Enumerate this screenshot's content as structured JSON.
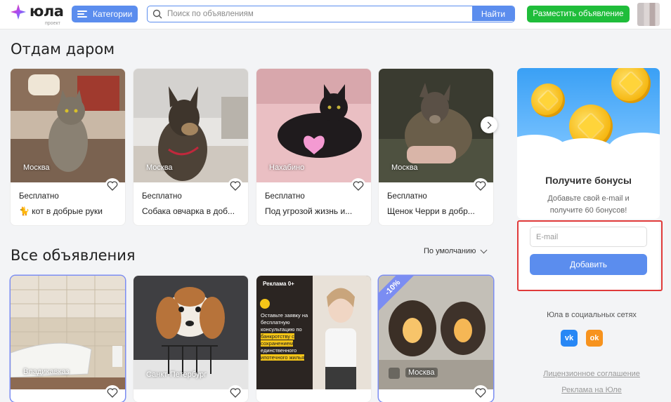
{
  "header": {
    "logo_text": "юла",
    "logo_sub": "проект",
    "categories_label": "Категории",
    "search_placeholder": "Поиск по объявлениям",
    "search_button": "Найти",
    "post_button": "Разместить объявление"
  },
  "giveaway": {
    "heading": "Отдам даром",
    "cards": [
      {
        "city": "Москва",
        "price": "Бесплатно",
        "title": "🐈 кот в добрые руки"
      },
      {
        "city": "Москва",
        "price": "Бесплатно",
        "title": "Собака овчарка в доб..."
      },
      {
        "city": "Нахабино",
        "price": "Бесплатно",
        "title": "Под угрозой жизнь и..."
      },
      {
        "city": "Москва",
        "price": "Бесплатно",
        "title": "Щенок Черри в добр..."
      }
    ]
  },
  "all_ads": {
    "heading": "Все объявления",
    "sort_label": "По умолчанию",
    "cards": [
      {
        "city": "Владикавказ"
      },
      {
        "city": "Санкт-Петербург"
      },
      {
        "ad_label": "Реклама 0+",
        "ad_text_1": "Оставьте заявку на бесплатную консультацию по ",
        "ad_highlight_1": "банкротству с сохранением",
        "ad_text_2": " единственного ",
        "ad_highlight_2": "ипотечного жилья"
      },
      {
        "city": "Москва",
        "discount": "-10%"
      }
    ]
  },
  "bonus": {
    "title": "Получите бонусы",
    "description": "Добавьте свой e-mail и получите 60 бонусов!",
    "email_placeholder": "E-mail",
    "add_button": "Добавить"
  },
  "social": {
    "title": "Юла в социальных сетях",
    "vk_label": "vk",
    "ok_label": "ok"
  },
  "footer_links": {
    "license": "Лицензионное соглашение",
    "advertising": "Реклама на Юле"
  },
  "colors": {
    "primary": "#5b8dee",
    "post_green": "#1fbd3a",
    "vk_blue": "#2787f5",
    "ok_orange": "#f7931e",
    "highlight_red": "#e03a3a"
  }
}
